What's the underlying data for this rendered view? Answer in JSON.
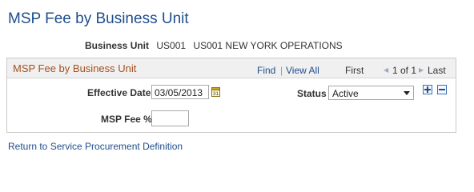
{
  "page": {
    "title": "MSP Fee by Business Unit"
  },
  "business_unit": {
    "label": "Business Unit",
    "value": "US001",
    "description": "US001 NEW YORK OPERATIONS"
  },
  "grid": {
    "title": "MSP Fee by Business Unit",
    "find": "Find",
    "separator": "|",
    "view_all": "View All",
    "first": "First",
    "prev_arrow": "◀",
    "count": "1 of 1",
    "next_arrow": "▶",
    "last": "Last"
  },
  "form": {
    "effective_date_label": "Effective Date",
    "effective_date_value": "03/05/2013",
    "status_label": "Status",
    "status_value": "Active",
    "msp_fee_label": "MSP Fee %",
    "msp_fee_value": ""
  },
  "footer": {
    "return_link": "Return to Service Procurement Definition"
  },
  "colors": {
    "title": "#1f4e8c",
    "section_title": "#a74f1a",
    "link": "#1f4e8c"
  },
  "icons": [
    "calendar-icon",
    "add-row-icon",
    "delete-row-icon",
    "dropdown-arrow-icon"
  ]
}
